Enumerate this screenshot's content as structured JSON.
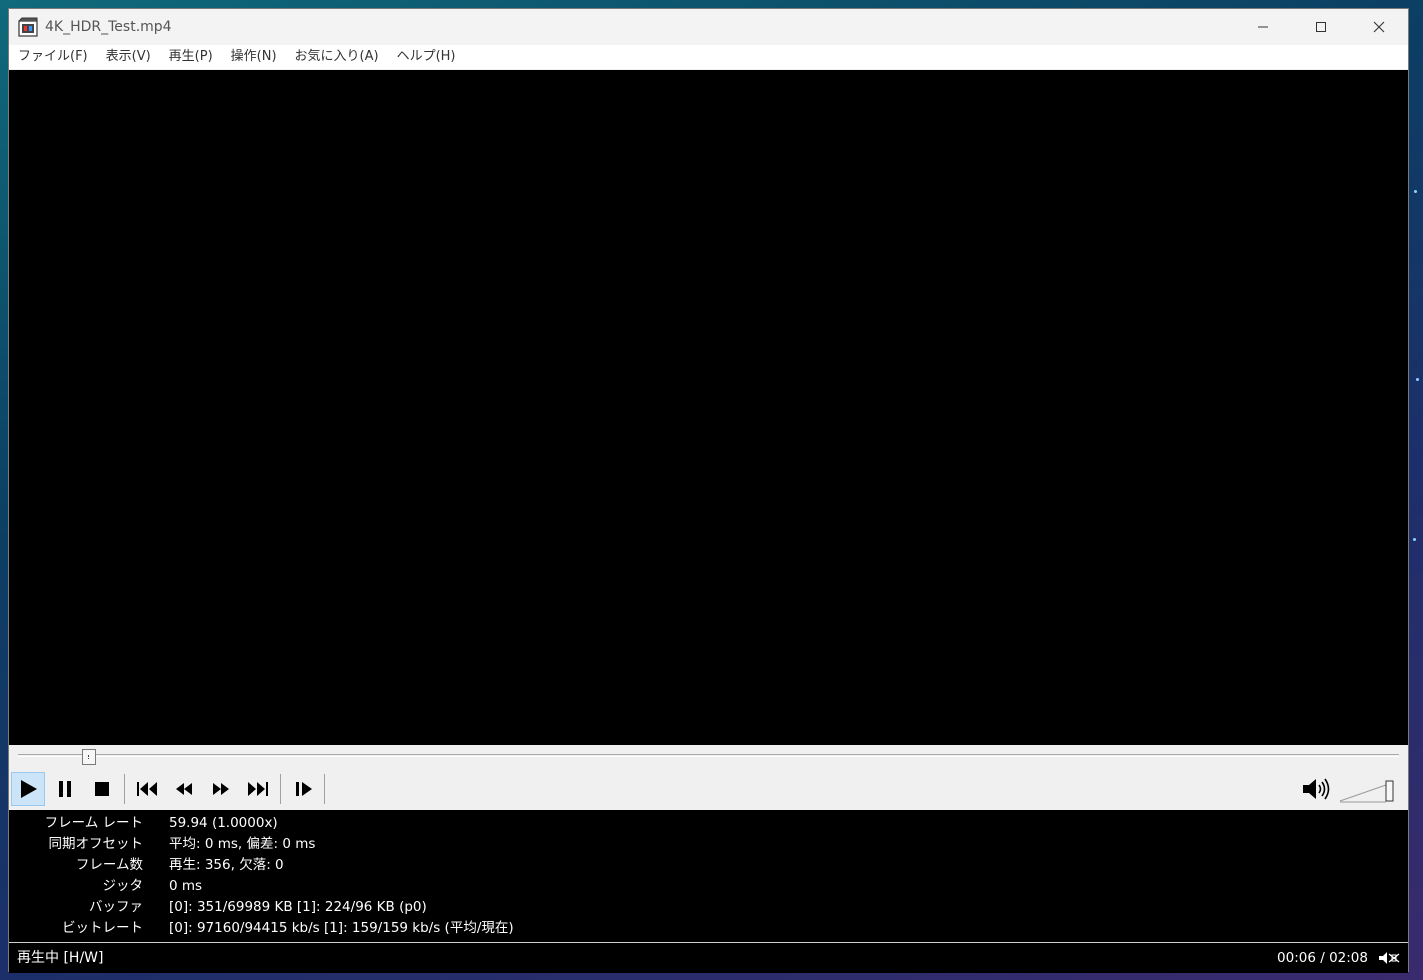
{
  "window": {
    "title": "4K_HDR_Test.mp4",
    "icon": "mpc-hc-app-icon"
  },
  "menu": {
    "items": [
      "ファイル(F)",
      "表示(V)",
      "再生(P)",
      "操作(N)",
      "お気に入り(A)",
      "ヘルプ(H)"
    ]
  },
  "seek": {
    "position_fraction": 0.047
  },
  "toolbar": {
    "buttons": [
      "play-icon",
      "pause-icon",
      "stop-icon",
      "skip-back-icon",
      "rewind-icon",
      "fast-forward-icon",
      "skip-forward-icon",
      "frame-step-icon"
    ],
    "active": "play-icon",
    "volume_fraction": 1.0
  },
  "stats": [
    {
      "label": "フレーム レート",
      "value": "59.94 (1.0000x)"
    },
    {
      "label": "同期オフセット",
      "value": "平均: 0 ms, 偏差: 0 ms"
    },
    {
      "label": "フレーム数",
      "value": "再生: 356, 欠落: 0"
    },
    {
      "label": "ジッタ",
      "value": "0 ms"
    },
    {
      "label": "バッファ",
      "value": "[0]: 351/69989 KB [1]: 224/96 KB (p0)"
    },
    {
      "label": "ビットレート",
      "value": "[0]: 97160/94415 kb/s [1]: 159/159 kb/s (平均/現在)"
    }
  ],
  "status": {
    "state": "再生中 [H/W]",
    "time": "00:06 / 02:08"
  }
}
